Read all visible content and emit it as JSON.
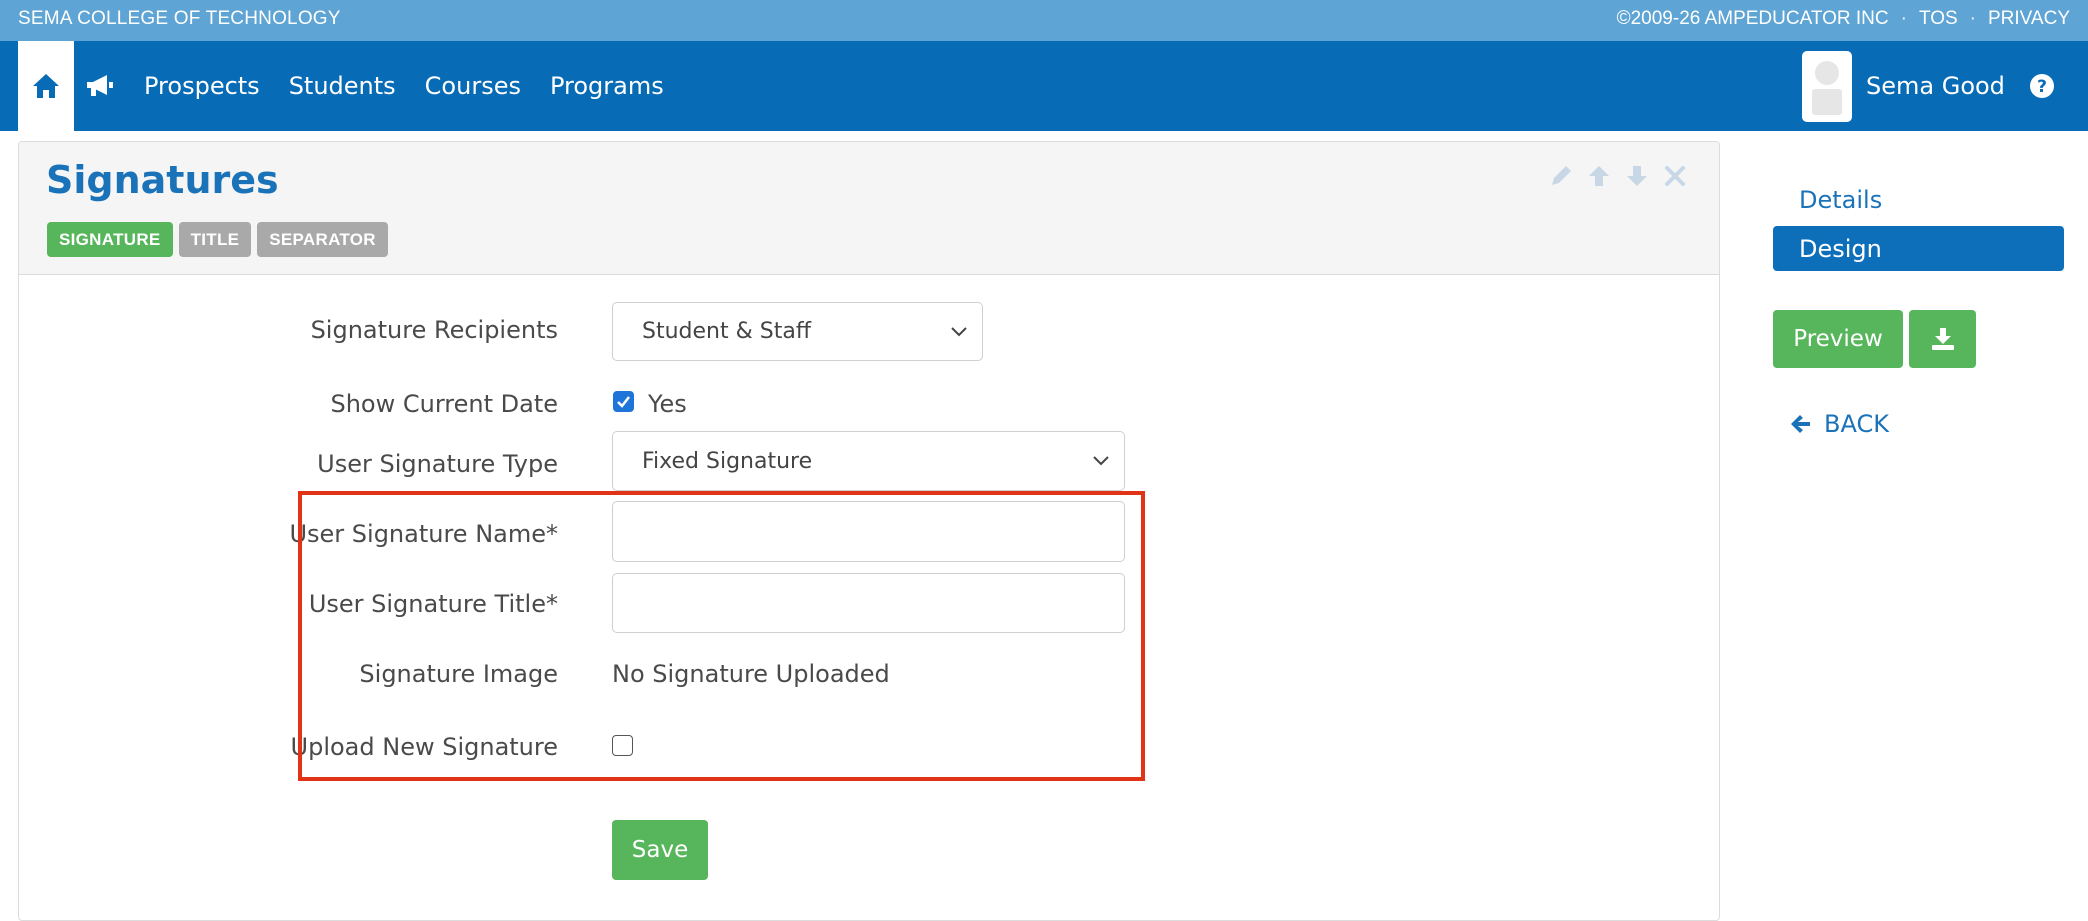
{
  "topbar": {
    "school_name": "SEMA COLLEGE OF TECHNOLOGY",
    "copyright": "©2009-26 AMPEDUCATOR INC",
    "sep1": "·",
    "tos": "TOS",
    "sep2": "·",
    "privacy": "PRIVACY"
  },
  "nav": {
    "home_icon": "home-icon",
    "announce_icon": "megaphone-icon",
    "items": [
      {
        "label": "Prospects"
      },
      {
        "label": "Students"
      },
      {
        "label": "Courses"
      },
      {
        "label": "Programs"
      }
    ],
    "user_name": "Sema Good",
    "help_icon": "question-circle-icon"
  },
  "panel": {
    "title": "Signatures",
    "tags": [
      {
        "label": "SIGNATURE",
        "active": true
      },
      {
        "label": "TITLE",
        "active": false
      },
      {
        "label": "SEPARATOR",
        "active": false
      }
    ],
    "tools": [
      "pencil-icon",
      "arrow-up-icon",
      "arrow-down-icon",
      "close-icon"
    ]
  },
  "form": {
    "recipients_label": "Signature Recipients",
    "recipients_value": "Student & Staff",
    "show_date_label": "Show Current Date",
    "show_date_checked": true,
    "show_date_option": "Yes",
    "sig_type_label": "User Signature Type",
    "sig_type_value": "Fixed Signature",
    "sig_name_label": "User Signature Name*",
    "sig_name_value": "",
    "sig_title_label": "User Signature Title*",
    "sig_title_value": "",
    "sig_image_label": "Signature Image",
    "sig_image_value": "No Signature Uploaded",
    "upload_label": "Upload New Signature",
    "upload_checked": false,
    "save_label": "Save"
  },
  "sidebar": {
    "details_label": "Details",
    "design_label": "Design",
    "preview_label": "Preview",
    "download_icon": "download-icon",
    "back_label": "BACK"
  },
  "colors": {
    "topbar": "#5ea4d5",
    "navbar": "#086bb6",
    "accent_green": "#57b65b",
    "link_blue": "#1a73b9",
    "highlight_red": "#e23317"
  }
}
